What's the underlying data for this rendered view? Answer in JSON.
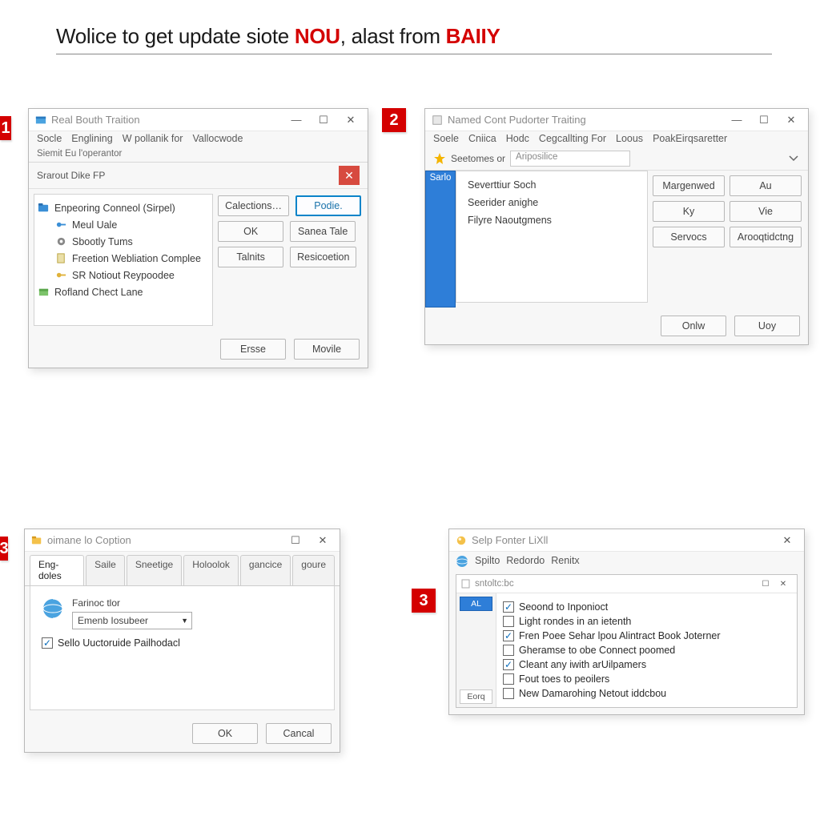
{
  "headline": {
    "t1": "Wolice to get update siote ",
    "red1": "NOU",
    "t2": ", alast from ",
    "red2": "BAIIY"
  },
  "badges": {
    "b1": "1",
    "b2": "2",
    "b3": "3",
    "b3b": "3"
  },
  "win1": {
    "title": "Real Bouth Traition",
    "menu": [
      "Socle",
      "Englining",
      "W pollanik for",
      "Vallocwode"
    ],
    "subheader": "Siemit Eu l'operantor",
    "search_label": "Srarout Dike FP",
    "tree": [
      {
        "label": "Enpeoring Conneol (Sirpel)",
        "icon": "folder"
      },
      {
        "label": "Meul Uale",
        "icon": "key",
        "child": true
      },
      {
        "label": "Sbootly Tums",
        "icon": "gear",
        "child": true
      },
      {
        "label": "Freetion Webliation Complee",
        "icon": "doc",
        "child": true
      },
      {
        "label": "SR Notiout Reypoodee",
        "icon": "key2",
        "child": true
      },
      {
        "label": "Rofland Chect Lane",
        "icon": "box"
      }
    ],
    "buttons": {
      "calections": "Calections…",
      "podie": "Podie.",
      "ok": "OK",
      "sanea": "Sanea Tale",
      "talits": "Talnits",
      "resico": "Resicoetion",
      "erse": "Ersse",
      "moole": "Movile"
    }
  },
  "win2": {
    "title": "Named Cont Pudorter Traiting",
    "menu": [
      "Soele",
      "Cniica",
      "Hodc",
      "Cegcallting For",
      "Loous",
      "PoakEirqsaretter"
    ],
    "search_label": "Seetomes or",
    "search_value": "Ariposilice",
    "side_tab": "Sarlo",
    "list": [
      {
        "label": "Severttiur Soch",
        "icon": "page"
      },
      {
        "label": "Seerider anighe",
        "icon": "monitor"
      },
      {
        "label": "Filyre Naoutgmens",
        "icon": "folderblue"
      }
    ],
    "buttons": {
      "margern": "Margenwed",
      "au": "Au",
      "ky": "Ky",
      "vie": "Vie",
      "servocs": "Servocs",
      "arooq": "Arooqtidctng",
      "onlv": "Onlw",
      "uoy": "Uoy"
    }
  },
  "win3": {
    "title": "oimane lo Coption",
    "tabs": [
      "Eng-doles",
      "Saile",
      "Sneetige",
      "Holoolok",
      "gancice",
      "goure"
    ],
    "label": "Farinoc tlor",
    "combo_value": "Emenb Iosubeer",
    "checkbox_label": "Sello Uuctoruide Pailhodacl",
    "ok": "OK",
    "cancel": "Cancal"
  },
  "win4": {
    "title": "Selp Fonter LiXll",
    "tabs": [
      "Spilto",
      "Redordo",
      "Renitx"
    ],
    "inner_title": "sntoltc:bc",
    "rail": [
      "AL",
      "Eorq"
    ],
    "checks": [
      {
        "checked": true,
        "label": "Seoond to Inponioct"
      },
      {
        "checked": false,
        "label": "Light rondes in an ietenth"
      },
      {
        "checked": true,
        "label": "Fren Poee Sehar lpou Alintract Book Joterner"
      },
      {
        "checked": false,
        "label": "Gheramse to obe Connect poomed"
      },
      {
        "checked": true,
        "label": "Cleant any iwith arUilpamers"
      },
      {
        "checked": false,
        "label": "Fout toes to peoilers"
      },
      {
        "checked": false,
        "label": "New Damarohing Netout iddcbou"
      }
    ]
  }
}
